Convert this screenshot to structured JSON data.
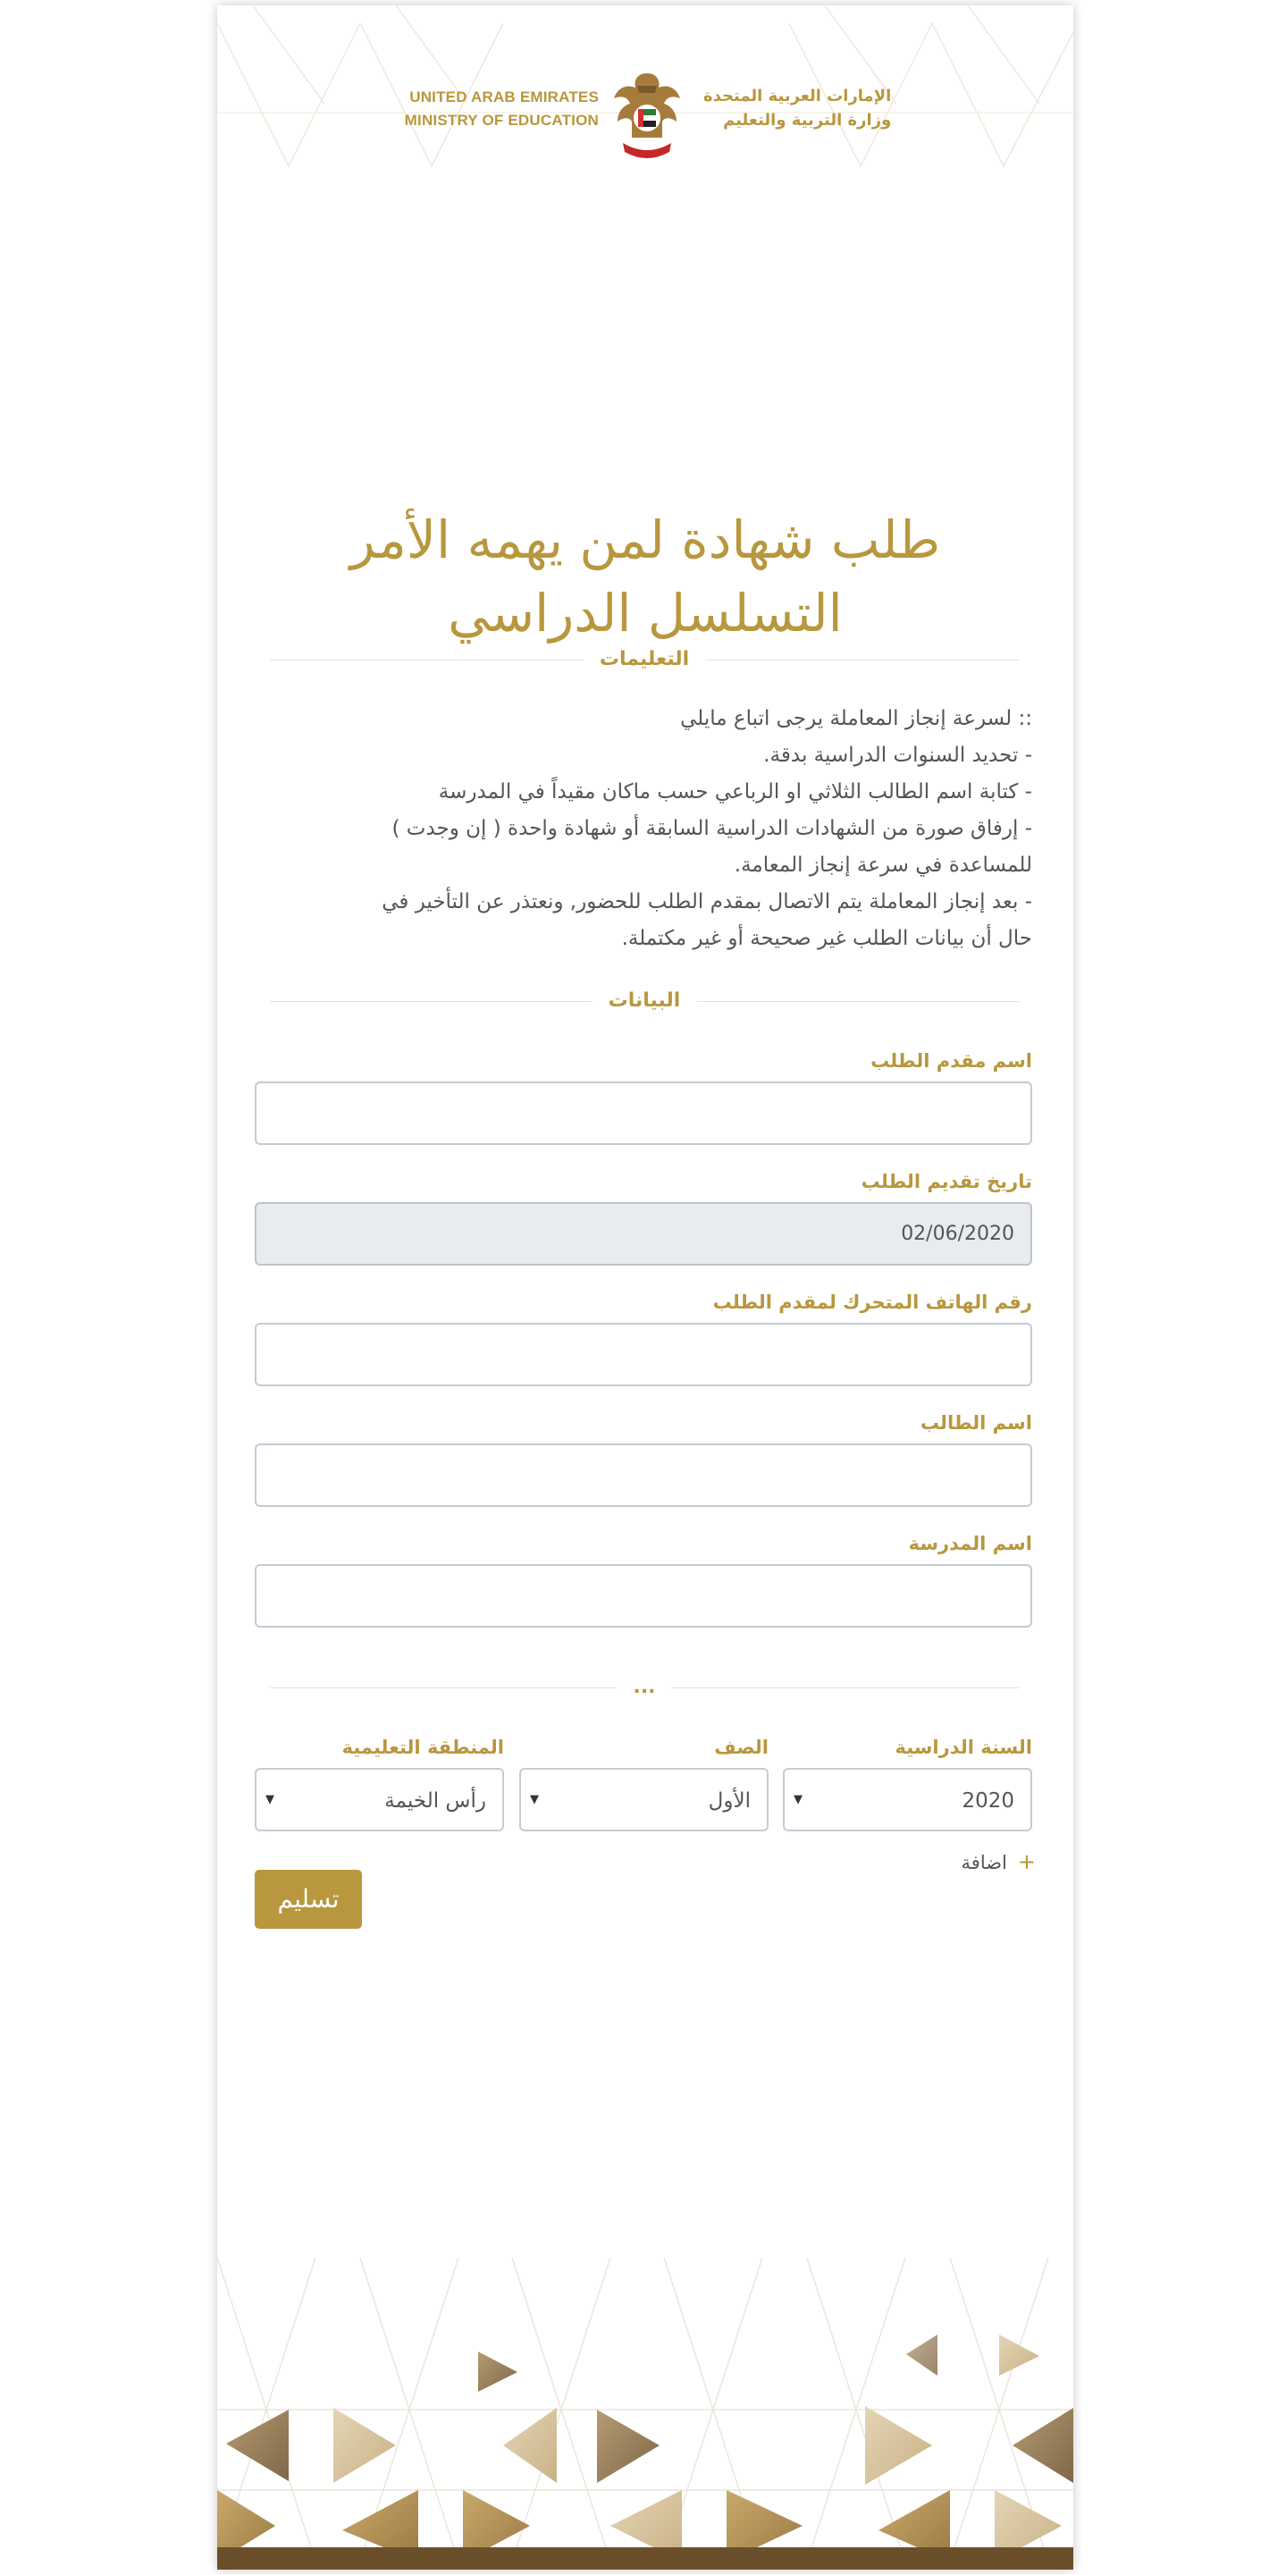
{
  "header": {
    "logo_en_line1": "UNITED ARAB EMIRATES",
    "logo_en_line2": "MINISTRY OF EDUCATION",
    "logo_ar_line1": "الإمارات العربية المتحدة",
    "logo_ar_line2": "وزارة التربية والتعليم",
    "emblem_icon": "uae-eagle-emblem-icon"
  },
  "title": {
    "line1": "طلب شهادة لمن يهمه الأمر",
    "line2": "التسلسل الدراسي"
  },
  "instructions": {
    "heading": "التعليمات",
    "lines": [
      ":: لسرعة إنجاز المعاملة يرجى اتباع مايلي",
      "- تحديد السنوات الدراسية بدقة.",
      "- كتابة اسم الطالب الثلاثي او الرباعي حسب ماكان مقيداً في المدرسة",
      "- إرفاق صورة من الشهادات الدراسية السابقة أو شهادة واحدة ( إن وجدت )",
      "للمساعدة في سرعة إنجاز المعامة.",
      "- بعد إنجاز المعاملة يتم الاتصال بمقدم الطلب للحضور, ونعتذر عن التأخير في",
      "حال أن بيانات الطلب غير صحيحة أو غير مكتملة."
    ]
  },
  "data_section": {
    "heading": "البيانات",
    "applicant_name_label": "اسم مقدم الطلب",
    "applicant_name_value": "",
    "request_date_label": "تاريخ تقديم الطلب",
    "request_date_value": "02/06/2020",
    "mobile_label": "رقم الهاتف المتحرك لمقدم الطلب",
    "mobile_value": "",
    "student_name_label": "اسم الطالب",
    "student_name_value": "",
    "school_name_label": "اسم المدرسة",
    "school_name_value": ""
  },
  "years_section": {
    "heading": "...",
    "academic_year_label": "السنة الدراسية",
    "academic_year_value": "2020",
    "grade_label": "الصف",
    "grade_value": "الأول",
    "region_label": "المنطقة التعليمية",
    "region_value": "رأس الخيمة",
    "add_label": "اضافة",
    "add_icon": "plus-icon",
    "arrow_icon": "caret-down-icon"
  },
  "submit_label": "تسليم",
  "colors": {
    "accent": "#b8973e",
    "text": "#555555",
    "input_border": "#c7cad6",
    "readonly_bg": "#e9ecef",
    "footer_bar": "#6b4f2a"
  }
}
